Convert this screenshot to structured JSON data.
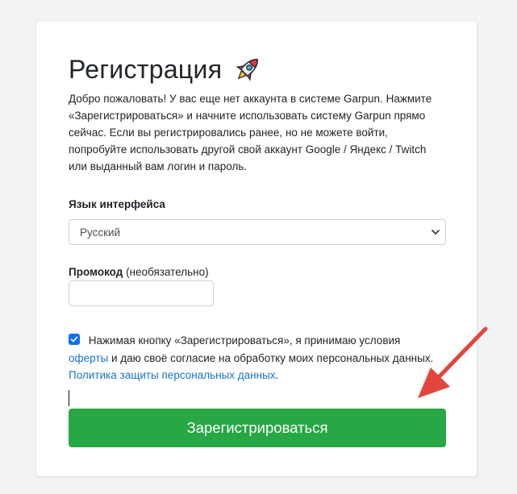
{
  "form": {
    "title": "Регистрация",
    "intro": "Добро пожаловать! У вас еще нет аккаунта в системе Garpun. Нажмите «Зарегистрироваться» и начните использовать систему Garpun прямо сейчас. Если вы регистрировались ранее, но не можете войти, попробуйте использовать другой свой аккаунт Google / Яндекс / Twitch или выданный вам логин и пароль.",
    "language_label": "Язык интерфейса",
    "language_value": "Русский",
    "promo_label": "Промокод",
    "promo_optional": "(необязательно)",
    "promo_value": "",
    "consent_checked": true,
    "consent_text_1": "Нажимая кнопку «Зарегистрироваться», я принимаю условия",
    "consent_link_offer": "оферты",
    "consent_text_2": " и даю своё согласие на обработку моих персональных данных.",
    "consent_link_privacy": "Политика защиты персональных данных",
    "consent_text_3": ".",
    "submit_label": "Зарегистрироваться"
  },
  "icons": {
    "rocket": "rocket-icon",
    "select_chevron": "chevron-down-icon",
    "checkbox_check": "checkmark-icon",
    "annotation_arrow": "red-arrow"
  },
  "colors": {
    "submit_bg": "#28a745",
    "link": "#1a73c8",
    "checkbox": "#0d6efd",
    "annotation_arrow": "#e2453c",
    "page_bg": "#f1f3f5"
  }
}
